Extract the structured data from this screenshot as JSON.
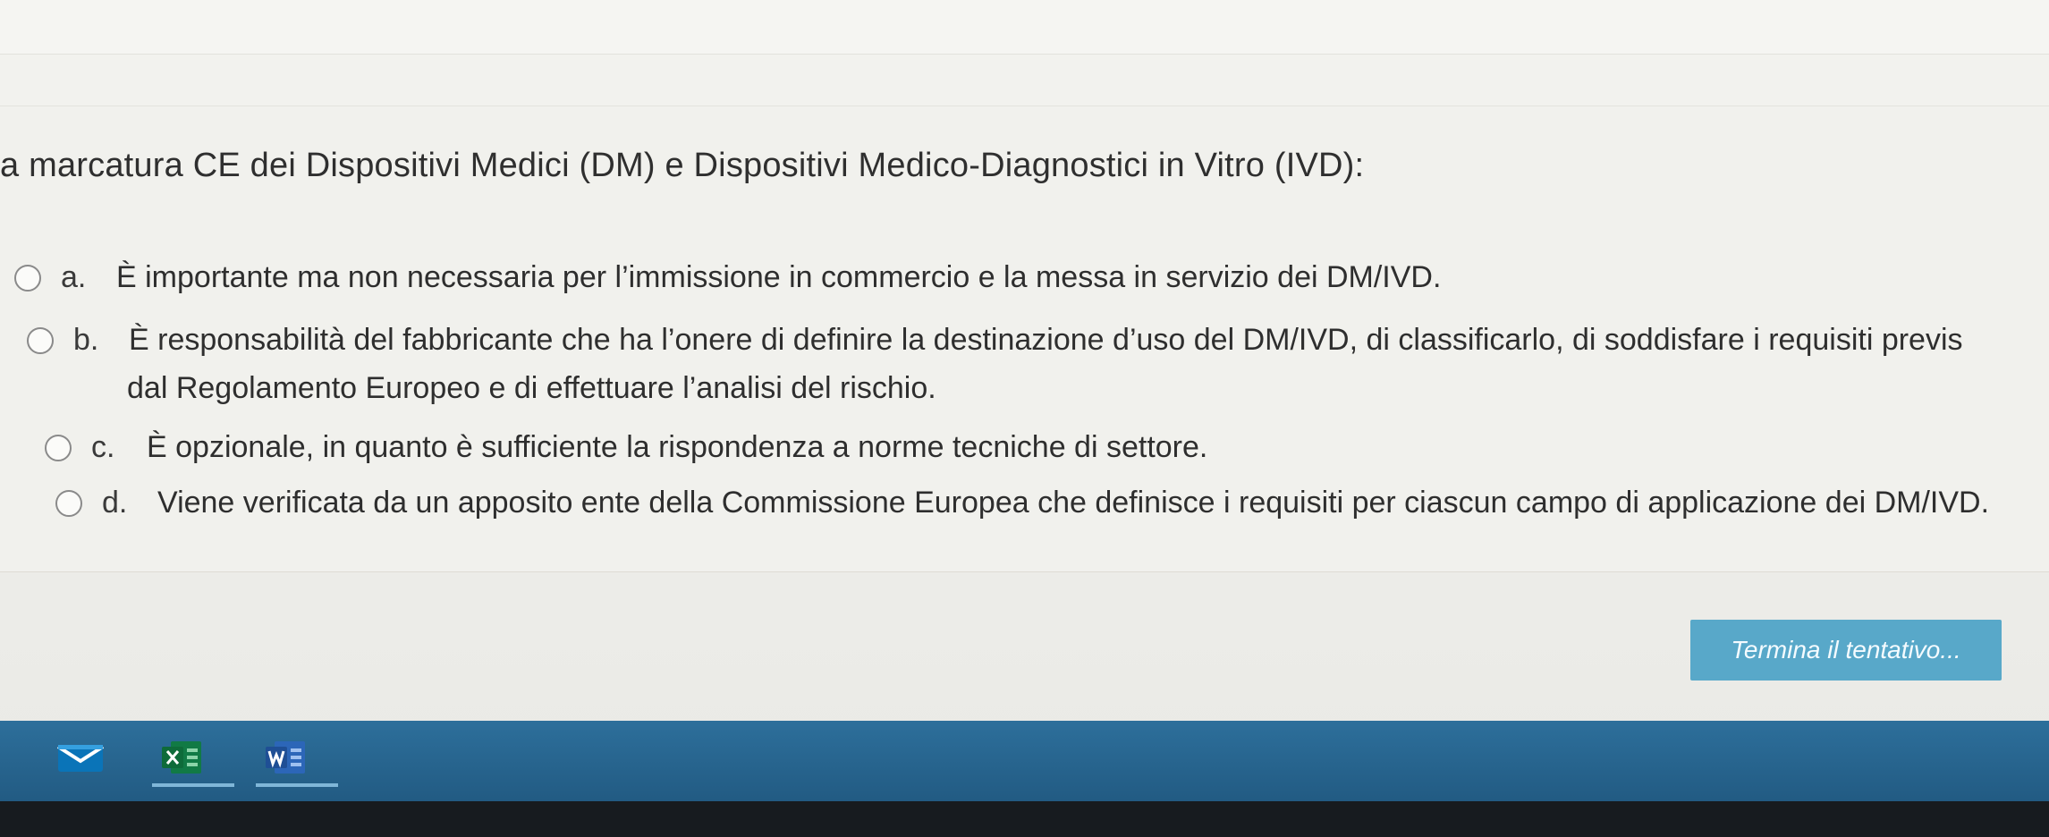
{
  "question": {
    "text": "a marcatura CE dei Dispositivi Medici (DM) e Dispositivi Medico-Diagnostici in Vitro (IVD):"
  },
  "answers": [
    {
      "letter": "a.",
      "text": "È importante ma non necessaria per l’immissione in commercio e la messa in servizio dei DM/IVD."
    },
    {
      "letter": "b.",
      "text_line1": "È responsabilità del fabbricante che ha l’onere di definire la destinazione d’uso del DM/IVD, di classificarlo, di soddisfare i requisiti previs",
      "text_line2": "dal Regolamento Europeo e di effettuare l’analisi del rischio."
    },
    {
      "letter": "c.",
      "text": "È opzionale, in quanto è sufficiente la rispondenza a norme tecniche di settore."
    },
    {
      "letter": "d.",
      "text": "Viene verificata da un apposito ente della Commissione Europea che definisce i requisiti per ciascun campo di applicazione dei DM/IVD."
    }
  ],
  "buttons": {
    "finish_attempt": "Termina il tentativo..."
  },
  "taskbar": {
    "icons": [
      "mail-icon",
      "excel-icon",
      "word-icon"
    ]
  }
}
